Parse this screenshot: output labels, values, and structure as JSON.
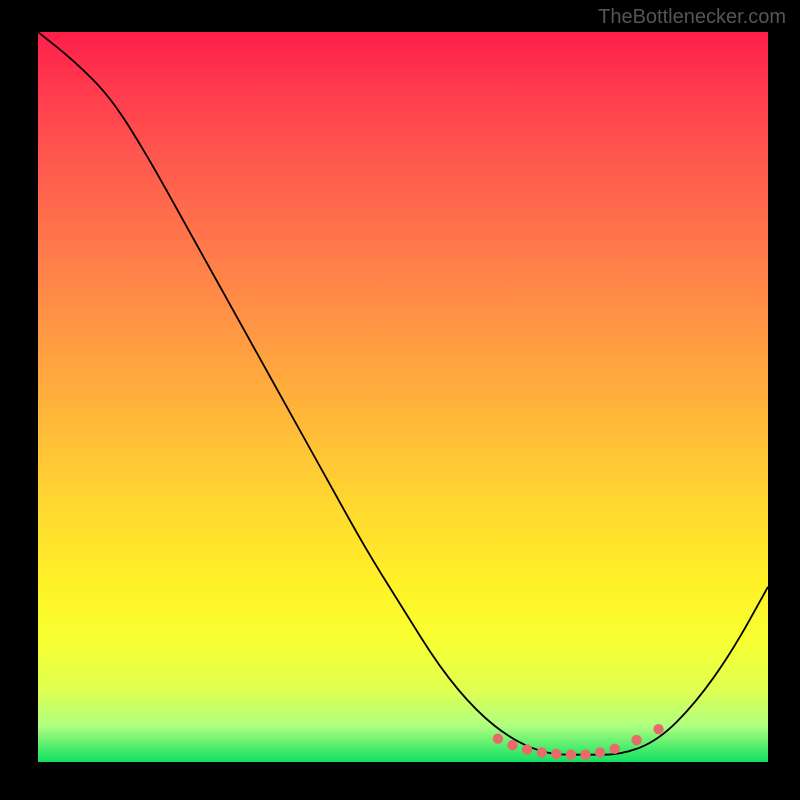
{
  "watermark": "TheBottlenecker.com",
  "chart_data": {
    "type": "line",
    "title": "",
    "xlabel": "",
    "ylabel": "",
    "xlim": [
      0,
      100
    ],
    "ylim": [
      0,
      100
    ],
    "series": [
      {
        "name": "curve",
        "x": [
          0,
          5,
          10,
          15,
          20,
          25,
          30,
          35,
          40,
          45,
          50,
          55,
          60,
          65,
          70,
          75,
          80,
          85,
          90,
          95,
          100
        ],
        "y": [
          100,
          96,
          91,
          83,
          74,
          65,
          56,
          47,
          38,
          29,
          21,
          13,
          7,
          3,
          1,
          1,
          1,
          3,
          8,
          15,
          24
        ]
      }
    ],
    "highlight_range": {
      "from": 63,
      "to": 85
    },
    "dots_x": [
      63,
      65,
      67,
      69,
      71,
      73,
      75,
      77,
      79,
      82,
      85
    ],
    "dots_y": [
      3.2,
      2.3,
      1.7,
      1.3,
      1.1,
      1.0,
      1.0,
      1.3,
      1.8,
      3.0,
      4.5
    ]
  }
}
